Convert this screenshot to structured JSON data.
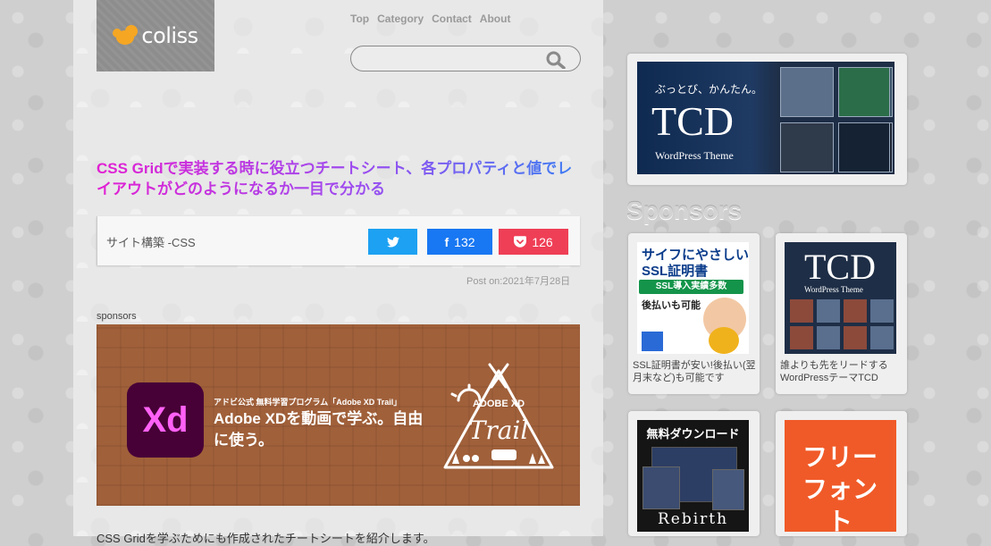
{
  "site": {
    "logo_text": "coliss"
  },
  "nav": {
    "items": [
      "Top",
      "Category",
      "Contact",
      "About"
    ]
  },
  "search": {
    "placeholder": "",
    "value": ""
  },
  "post": {
    "title": "CSS Gridで実装する時に役立つチートシート、各プロパティと値でレイアウトがどのようになるか一目で分かる",
    "category": "サイト構築 -CSS",
    "facebook_count": "132",
    "pocket_count": "126",
    "date": "Post on:2021年7月28日",
    "peek_text": "CSS Gridを学ぶためにも作成されたチートシートを紹介します。"
  },
  "ad": {
    "label": "sponsors",
    "icon_text": "Xd",
    "small_text": "アドビ公式 無料学習プログラム「Adobe XD Trail」",
    "headline": "Adobe XDを動画で学ぶ。自由に使う。",
    "logo_top": "ADOBE XD",
    "logo_word": "Trail"
  },
  "sidebar": {
    "tcd_banner": {
      "tagline": "ぶっとび、かんたん。",
      "brand": "TCD",
      "subtitle": "WordPress Theme"
    },
    "sponsors_heading": "Sponsors",
    "cards": [
      {
        "heading": "サイフにやさしいSSL証明書",
        "badge": "SSL導入実績多数",
        "note": "後払いも可能",
        "caption": "SSL証明書が安い!後払い(翌月末など)も可能です"
      },
      {
        "brand": "TCD",
        "subtitle": "WordPress Theme",
        "caption": "誰よりも先をリードするWordPressテーマTCD"
      },
      {
        "heading": "無料ダウンロード",
        "word": "Rebirth"
      },
      {
        "text": "フリーフォント"
      }
    ]
  },
  "colors": {
    "title_gradient_start": "#e21fd3",
    "title_gradient_end": "#3a7df3",
    "twitter": "#1da1f2",
    "facebook": "#1877f2",
    "pocket": "#ef3f56",
    "ad_bg": "#a0603a"
  }
}
